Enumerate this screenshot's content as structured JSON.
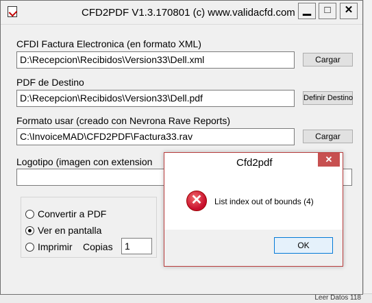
{
  "window": {
    "title": "CFD2PDF V1.3.170801     (c) www.validacfd.com",
    "minimize": "▁",
    "maximize": "□",
    "close": "✕"
  },
  "xml": {
    "label": "CFDI Factura Electronica (en formato XML)",
    "value": "D:\\Recepcion\\Recibidos\\Version33\\Dell.xml",
    "button": "Cargar"
  },
  "pdf": {
    "label": "PDF de Destino",
    "value": "D:\\Recepcion\\Recibidos\\Version33\\Dell.pdf",
    "button": "Definir Destino"
  },
  "format": {
    "label": "Formato usar (creado con Nevrona Rave Reports)",
    "value": "C:\\InvoiceMAD\\CFD2PDF\\Factura33.rav",
    "button": "Cargar"
  },
  "logo": {
    "label": "Logotipo (imagen con extension",
    "value": ""
  },
  "options": {
    "convert": "Convertir a PDF",
    "screen": "Ver en pantalla",
    "print": "Imprimir",
    "copies_label": "Copias",
    "copies_value": "1",
    "selected": "screen"
  },
  "dialog": {
    "title": "Cfd2pdf",
    "close": "✕",
    "message": "List index out of bounds (4)",
    "ok": "OK"
  },
  "background": {
    "bottom_text": "Leer Datos 118"
  },
  "colors": {
    "error_red": "#c8102e",
    "ok_border": "#0078d7",
    "dialog_close": "#c75050"
  }
}
